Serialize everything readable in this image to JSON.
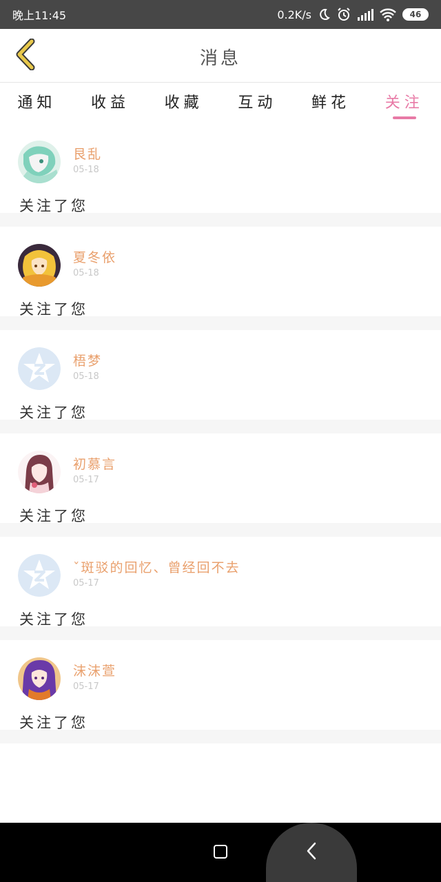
{
  "status_bar": {
    "time": "晚上11:45",
    "net_speed": "0.2K/s",
    "battery": "46"
  },
  "header": {
    "title": "消息",
    "back_icon": "chevron-left-icon",
    "back_color": "#e8c84a"
  },
  "tabs": [
    {
      "label": "通知",
      "active": false
    },
    {
      "label": "收益",
      "active": false
    },
    {
      "label": "收藏",
      "active": false
    },
    {
      "label": "互动",
      "active": false
    },
    {
      "label": "鲜花",
      "active": false
    },
    {
      "label": "关注",
      "active": true
    }
  ],
  "colors": {
    "accent": "#e87aa6",
    "username": "#e9a06d",
    "date": "#c8c8c8"
  },
  "messages": [
    {
      "username": "艮乱",
      "date": "05-18",
      "text": "关注了您",
      "avatar": "anime-avatar-green"
    },
    {
      "username": "夏冬依",
      "date": "05-18",
      "text": "关注了您",
      "avatar": "anime-avatar-gold"
    },
    {
      "username": "梧梦",
      "date": "05-18",
      "text": "关注了您",
      "avatar": "default-avatar"
    },
    {
      "username": "初慕言",
      "date": "05-17",
      "text": "关注了您",
      "avatar": "anime-avatar-pink"
    },
    {
      "username": "ˇ斑驳的回忆、曾经回不去",
      "date": "05-17",
      "text": "关注了您",
      "avatar": "default-avatar"
    },
    {
      "username": "沫沫萱",
      "date": "05-17",
      "text": "关注了您",
      "avatar": "anime-avatar-purple"
    }
  ]
}
